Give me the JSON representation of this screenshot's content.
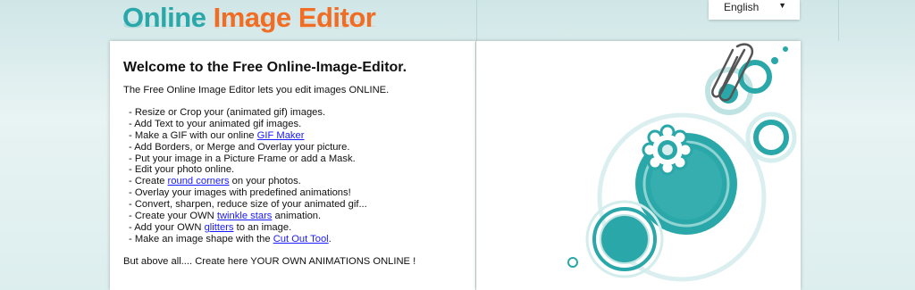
{
  "header": {
    "logo_word1": "Online",
    "logo_word2": "Image",
    "logo_word3": "Editor",
    "language": {
      "selected": "English",
      "arrow": "▼"
    }
  },
  "main": {
    "title": "Welcome to the Free Online-Image-Editor.",
    "intro": "The Free Online Image Editor lets you edit images ONLINE.",
    "features": [
      {
        "pre": "- Resize or Crop your (animated gif) images.",
        "link": "",
        "post": ""
      },
      {
        "pre": "- Add Text to your animated gif images.",
        "link": "",
        "post": ""
      },
      {
        "pre": "- Make a GIF with our online ",
        "link": "GIF Maker",
        "post": ""
      },
      {
        "pre": "- Add Borders, or Merge and Overlay your picture.",
        "link": "",
        "post": ""
      },
      {
        "pre": "- Put your image in a Picture Frame or add a Mask.",
        "link": "",
        "post": ""
      },
      {
        "pre": "- Edit your photo online.",
        "link": "",
        "post": ""
      },
      {
        "pre": "- Create ",
        "link": "round corners",
        "post": " on your photos."
      },
      {
        "pre": "- Overlay your images with predefined animations",
        "link": "",
        "post": "!"
      },
      {
        "pre": "- Convert, sharpen, reduce size of your animated gif...",
        "link": "",
        "post": ""
      },
      {
        "pre": "- Create your OWN ",
        "link": "twinkle stars",
        "post": " animation."
      },
      {
        "pre": "- Add your OWN ",
        "link": "glitters",
        "post": " to an image."
      },
      {
        "pre": "- Make an image shape with the ",
        "link": "Cut Out Tool",
        "post": "."
      }
    ],
    "footer_text": "But above all.... Create here YOUR OWN ANIMATIONS ONLINE !"
  },
  "colors": {
    "teal": "#2aa7a8",
    "orange": "#f06d23",
    "link": "#1a1aff"
  }
}
